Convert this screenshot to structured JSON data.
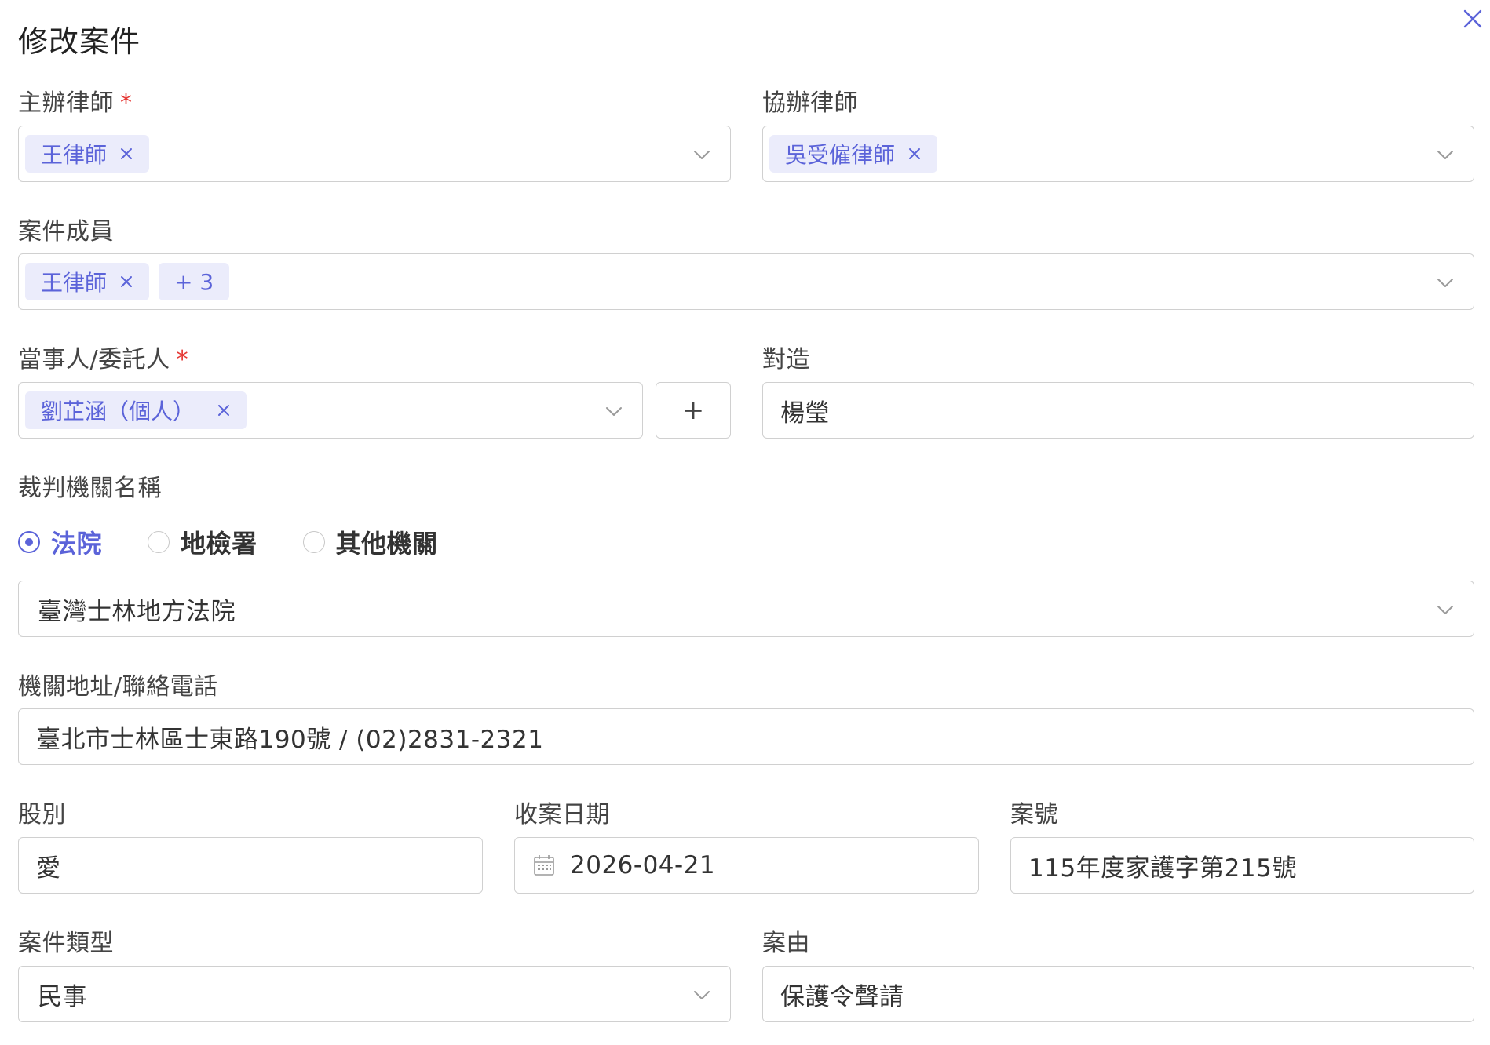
{
  "dialog": {
    "title": "修改案件",
    "close_icon": "close-icon"
  },
  "colors": {
    "accent": "#5b63d9",
    "tag_bg": "#ebecfb",
    "required": "#e53935",
    "border": "#d0d0d0"
  },
  "lead_lawyer": {
    "label": "主辦律師",
    "required_mark": "*",
    "tags": [
      "王律師"
    ]
  },
  "assisting_lawyer": {
    "label": "協辦律師",
    "tags": [
      "吳受僱律師"
    ]
  },
  "case_members": {
    "label": "案件成員",
    "tags": [
      "王律師"
    ],
    "more": "+ 3"
  },
  "client": {
    "label": "當事人/委託人",
    "required_mark": "*",
    "tags": [
      "劉芷涵（個人）"
    ],
    "add_label": "+"
  },
  "opposing_party": {
    "label": "對造",
    "value": "楊瑩"
  },
  "court": {
    "label": "裁判機關名稱",
    "options": [
      "法院",
      "地檢署",
      "其他機關"
    ],
    "selected": "法院",
    "value": "臺灣士林地方法院"
  },
  "court_address": {
    "label": "機關地址/聯絡電話",
    "value": "臺北市士林區士東路190號 / (02)2831-2321"
  },
  "division": {
    "label": "股別",
    "value": "愛"
  },
  "filing_date": {
    "label": "收案日期",
    "icon": "calendar-icon",
    "value": "2026-04-21"
  },
  "case_number": {
    "label": "案號",
    "value": "115年度家護字第215號"
  },
  "case_type": {
    "label": "案件類型",
    "value": "民事"
  },
  "cause": {
    "label": "案由",
    "value": "保護令聲請"
  }
}
